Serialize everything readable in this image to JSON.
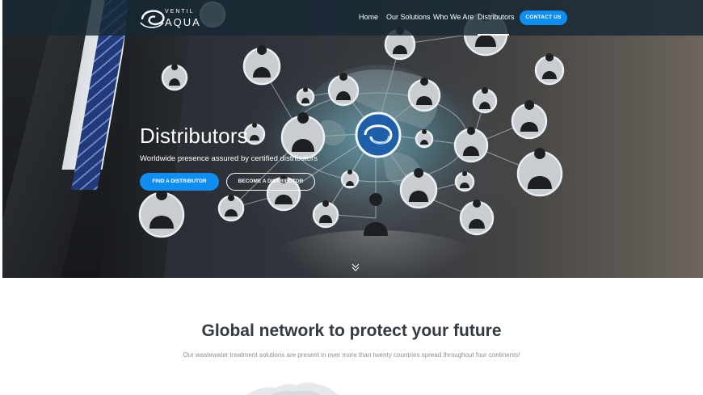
{
  "brand": {
    "top_word": "VENTIL",
    "name": "AQUA"
  },
  "nav": {
    "items": [
      {
        "label": "Home"
      },
      {
        "label": "Our Solutions"
      },
      {
        "label": "Who We Are"
      },
      {
        "label": "Distributors",
        "active": true
      }
    ],
    "contact_label": "CONTACT US"
  },
  "hero": {
    "title": "Distributors",
    "subtitle": "Worldwide presence assured by certified distributors",
    "primary_button": "FIND A DISTRIBUTOR",
    "secondary_button": "BECOME A DISTRIBUTOR"
  },
  "section": {
    "title_bold": "Global network",
    "title_rest": " to protect your future",
    "subtitle": "Our wastewater treatment solutions are present in over more than twenty countries spread throughout four continents!"
  },
  "colors": {
    "accent": "#0f8ef0",
    "header_bg": "#16283a",
    "heading": "#333a42"
  }
}
